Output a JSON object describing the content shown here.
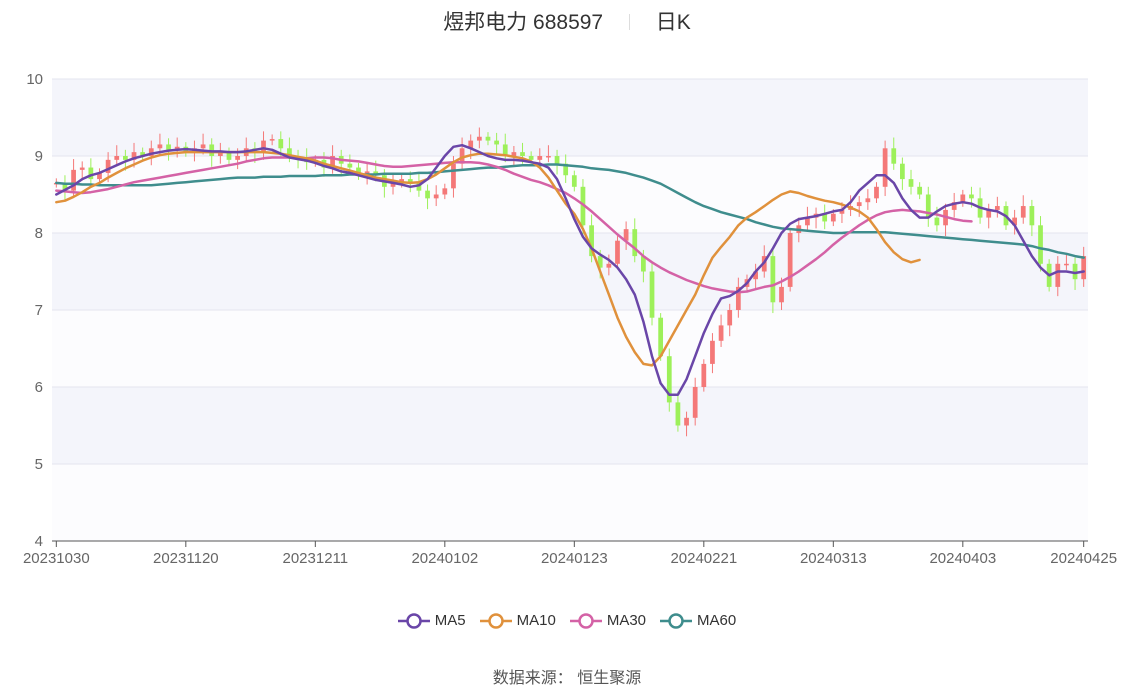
{
  "title": {
    "stock_name": "煜邦电力",
    "stock_code": "688597",
    "period": "日K"
  },
  "source": {
    "label": "数据来源：",
    "provider": "恒生聚源"
  },
  "legend": [
    {
      "name": "MA5",
      "color": "#6a46a8"
    },
    {
      "name": "MA10",
      "color": "#e0913c"
    },
    {
      "name": "MA30",
      "color": "#d462a6"
    },
    {
      "name": "MA60",
      "color": "#3f8d8d"
    }
  ],
  "chart_data": {
    "type": "candlestick",
    "ylim": [
      4,
      10
    ],
    "y_ticks": [
      "4",
      "5",
      "6",
      "7",
      "8",
      "9",
      "10"
    ],
    "x_tick_labels": [
      {
        "index": 0,
        "label": "20231030"
      },
      {
        "index": 15,
        "label": "20231120"
      },
      {
        "index": 30,
        "label": "20231211"
      },
      {
        "index": 45,
        "label": "20240102"
      },
      {
        "index": 60,
        "label": "20240123"
      },
      {
        "index": 75,
        "label": "20240221"
      },
      {
        "index": 90,
        "label": "20240313"
      },
      {
        "index": 105,
        "label": "20240403"
      },
      {
        "index": 119,
        "label": "20240425"
      }
    ],
    "up_color": "#f47878",
    "down_color": "#9df05a",
    "close": [
      8.65,
      8.55,
      8.82,
      8.85,
      8.7,
      8.78,
      8.95,
      9.0,
      8.95,
      9.05,
      9.0,
      9.1,
      9.15,
      9.08,
      9.12,
      9.05,
      9.1,
      9.15,
      9.0,
      9.05,
      8.95,
      9.0,
      9.1,
      9.05,
      9.2,
      9.22,
      9.1,
      9.0,
      8.98,
      8.92,
      8.95,
      8.85,
      9.0,
      8.9,
      8.85,
      8.75,
      8.8,
      8.75,
      8.6,
      8.65,
      8.7,
      8.65,
      8.55,
      8.45,
      8.5,
      8.58,
      8.9,
      9.1,
      9.2,
      9.25,
      9.2,
      9.15,
      9.0,
      9.05,
      9.0,
      8.95,
      9.0,
      9.0,
      8.9,
      8.75,
      8.6,
      8.1,
      7.7,
      7.55,
      7.6,
      7.9,
      8.05,
      7.7,
      7.5,
      6.9,
      6.4,
      5.8,
      5.5,
      5.6,
      6.0,
      6.3,
      6.6,
      6.8,
      7.0,
      7.3,
      7.4,
      7.5,
      7.7,
      7.1,
      7.3,
      8.0,
      8.1,
      8.2,
      8.25,
      8.15,
      8.25,
      8.3,
      8.35,
      8.4,
      8.45,
      8.6,
      9.1,
      8.9,
      8.7,
      8.6,
      8.5,
      8.2,
      8.1,
      8.3,
      8.4,
      8.5,
      8.45,
      8.2,
      8.3,
      8.35,
      8.1,
      8.2,
      8.35,
      8.1,
      7.6,
      7.3,
      7.6,
      7.6,
      7.4,
      7.7
    ],
    "ma5": [
      8.5,
      8.56,
      8.62,
      8.7,
      8.75,
      8.78,
      8.83,
      8.88,
      8.93,
      8.97,
      9.0,
      9.03,
      9.05,
      9.07,
      9.08,
      9.09,
      9.08,
      9.07,
      9.06,
      9.06,
      9.05,
      9.05,
      9.06,
      9.08,
      9.1,
      9.08,
      9.03,
      8.98,
      8.96,
      8.94,
      8.91,
      8.87,
      8.84,
      8.8,
      8.78,
      8.75,
      8.72,
      8.69,
      8.67,
      8.65,
      8.63,
      8.6,
      8.62,
      8.7,
      8.85,
      9.0,
      9.12,
      9.14,
      9.1,
      9.05,
      9.0,
      8.97,
      8.95,
      8.95,
      8.94,
      8.92,
      8.9,
      8.85,
      8.7,
      8.45,
      8.18,
      7.95,
      7.8,
      7.72,
      7.65,
      7.55,
      7.4,
      7.2,
      6.85,
      6.4,
      6.05,
      5.9,
      5.9,
      6.1,
      6.4,
      6.7,
      6.95,
      7.15,
      7.18,
      7.25,
      7.35,
      7.5,
      7.62,
      7.8,
      8.0,
      8.12,
      8.18,
      8.2,
      8.22,
      8.25,
      8.28,
      8.3,
      8.4,
      8.55,
      8.65,
      8.75,
      8.75,
      8.65,
      8.45,
      8.3,
      8.2,
      8.2,
      8.28,
      8.35,
      8.38,
      8.4,
      8.38,
      8.33,
      8.3,
      8.28,
      8.22,
      8.1,
      7.9,
      7.7,
      7.55,
      7.45,
      7.5,
      7.5,
      7.48,
      7.5
    ],
    "ma10": [
      8.4,
      8.42,
      8.47,
      8.53,
      8.6,
      8.65,
      8.72,
      8.78,
      8.84,
      8.89,
      8.94,
      8.98,
      9.01,
      9.03,
      9.04,
      9.05,
      9.05,
      9.05,
      9.05,
      9.05,
      9.05,
      9.05,
      9.05,
      9.05,
      9.05,
      9.04,
      9.03,
      9.01,
      8.99,
      8.97,
      8.94,
      8.9,
      8.87,
      8.84,
      8.81,
      8.78,
      8.75,
      8.72,
      8.7,
      8.68,
      8.66,
      8.65,
      8.66,
      8.7,
      8.76,
      8.84,
      8.92,
      8.98,
      9.01,
      9.03,
      9.03,
      9.02,
      9.01,
      8.99,
      8.97,
      8.93,
      8.85,
      8.72,
      8.55,
      8.38,
      8.25,
      8.05,
      7.8,
      7.5,
      7.2,
      6.9,
      6.65,
      6.45,
      6.3,
      6.28,
      6.4,
      6.6,
      6.8,
      7.0,
      7.2,
      7.45,
      7.68,
      7.82,
      7.95,
      8.1,
      8.2,
      8.27,
      8.35,
      8.43,
      8.5,
      8.54,
      8.52,
      8.48,
      8.45,
      8.42,
      8.4,
      8.37,
      8.33,
      8.28,
      8.2,
      8.05,
      7.88,
      7.75,
      7.66,
      7.62,
      7.65
    ],
    "ma30": [
      8.55,
      8.54,
      8.53,
      8.52,
      8.53,
      8.55,
      8.57,
      8.6,
      8.63,
      8.66,
      8.68,
      8.7,
      8.72,
      8.74,
      8.76,
      8.78,
      8.8,
      8.82,
      8.84,
      8.86,
      8.88,
      8.9,
      8.93,
      8.95,
      8.97,
      8.98,
      8.98,
      8.98,
      8.97,
      8.97,
      8.98,
      8.98,
      8.97,
      8.95,
      8.94,
      8.93,
      8.91,
      8.89,
      8.87,
      8.86,
      8.86,
      8.87,
      8.88,
      8.89,
      8.9,
      8.91,
      8.92,
      8.92,
      8.92,
      8.91,
      8.89,
      8.86,
      8.82,
      8.77,
      8.73,
      8.69,
      8.66,
      8.62,
      8.57,
      8.52,
      8.45,
      8.37,
      8.28,
      8.18,
      8.08,
      7.98,
      7.89,
      7.8,
      7.7,
      7.62,
      7.55,
      7.49,
      7.44,
      7.39,
      7.35,
      7.31,
      7.28,
      7.26,
      7.24,
      7.23,
      7.24,
      7.27,
      7.3,
      7.32,
      7.37,
      7.43,
      7.5,
      7.58,
      7.66,
      7.75,
      7.85,
      7.94,
      8.02,
      8.1,
      8.17,
      8.23,
      8.27,
      8.29,
      8.3,
      8.29,
      8.28,
      8.26,
      8.24,
      8.21,
      8.18,
      8.16,
      8.15
    ],
    "ma60": [
      8.65,
      8.64,
      8.64,
      8.63,
      8.63,
      8.62,
      8.62,
      8.62,
      8.62,
      8.62,
      8.62,
      8.62,
      8.63,
      8.64,
      8.65,
      8.66,
      8.67,
      8.68,
      8.69,
      8.7,
      8.71,
      8.72,
      8.72,
      8.72,
      8.73,
      8.73,
      8.73,
      8.74,
      8.74,
      8.74,
      8.74,
      8.75,
      8.75,
      8.75,
      8.76,
      8.76,
      8.76,
      8.76,
      8.77,
      8.77,
      8.77,
      8.77,
      8.78,
      8.78,
      8.79,
      8.8,
      8.81,
      8.82,
      8.83,
      8.84,
      8.85,
      8.85,
      8.86,
      8.87,
      8.88,
      8.88,
      8.88,
      8.89,
      8.89,
      8.88,
      8.87,
      8.86,
      8.84,
      8.83,
      8.82,
      8.8,
      8.78,
      8.75,
      8.72,
      8.68,
      8.64,
      8.58,
      8.52,
      8.46,
      8.4,
      8.35,
      8.31,
      8.27,
      8.24,
      8.21,
      8.18,
      8.14,
      8.11,
      8.08,
      8.06,
      8.05,
      8.04,
      8.03,
      8.02,
      8.01,
      8.0,
      8.0,
      8.01,
      8.01,
      8.01,
      8.01,
      8.01,
      8.0,
      7.99,
      7.98,
      7.97,
      7.96,
      7.95,
      7.94,
      7.93,
      7.92,
      7.91,
      7.9,
      7.89,
      7.88,
      7.87,
      7.86,
      7.85,
      7.83,
      7.8,
      7.78,
      7.75,
      7.73,
      7.7,
      7.68
    ]
  }
}
